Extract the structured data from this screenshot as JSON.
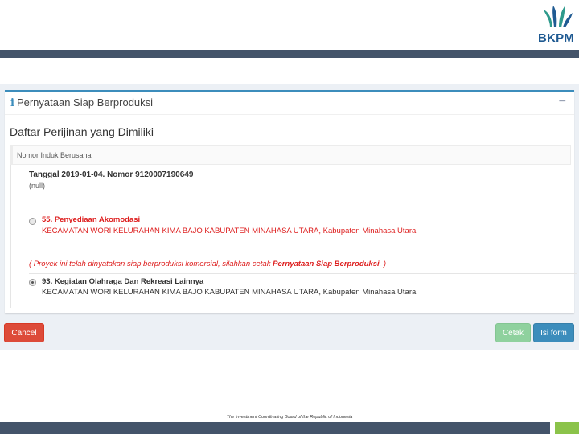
{
  "brand": {
    "name": "BKPM",
    "color": "#1f5a92",
    "mark_color": "#2e9a8c",
    "logo_icon": "bkpm-leaf-logo"
  },
  "panel": {
    "title": "Pernyataan Siap Berproduksi",
    "info_icon": "i",
    "collapse_icon": "−",
    "section_title": "Daftar Perijinan yang Dimiliki",
    "nib_label": "Nomor Induk Berusaha",
    "record": {
      "date_line": "Tanggal 2019-01-04. Nomor 9120007190649",
      "null_text": "(null)",
      "items": [
        {
          "name": "55. Penyediaan Akomodasi",
          "address": "KECAMATAN WORI KELURAHAN KIMA BAJO KABUPATEN MINAHASA UTARA, Kabupaten Minahasa Utara",
          "selected": false,
          "color": "#dd1c1c"
        },
        {
          "name": "93. Kegiatan Olahraga Dan Rekreasi Lainnya",
          "address": "KECAMATAN WORI KELURAHAN KIMA BAJO KABUPATEN MINAHASA UTARA, Kabupaten Minahasa Utara",
          "selected": true,
          "color": "#333333"
        }
      ],
      "notice_prefix": "( Proyek ini telah dinyatakan siap berproduksi komersial, silahkan cetak ",
      "notice_bold": "Pernyataan Siap Berproduksi",
      "notice_suffix": ". )"
    }
  },
  "buttons": {
    "cancel": "Cancel",
    "print": "Cetak",
    "fill": "Isi form"
  },
  "footer": {
    "text": "The Investment Coordinating Board of the Republic of Indonesia"
  },
  "colors": {
    "primary": "#3c8dbc",
    "danger": "#dd4b39",
    "success_muted": "#8fd19e",
    "bar": "#44546a",
    "accent": "#8bc34a"
  }
}
